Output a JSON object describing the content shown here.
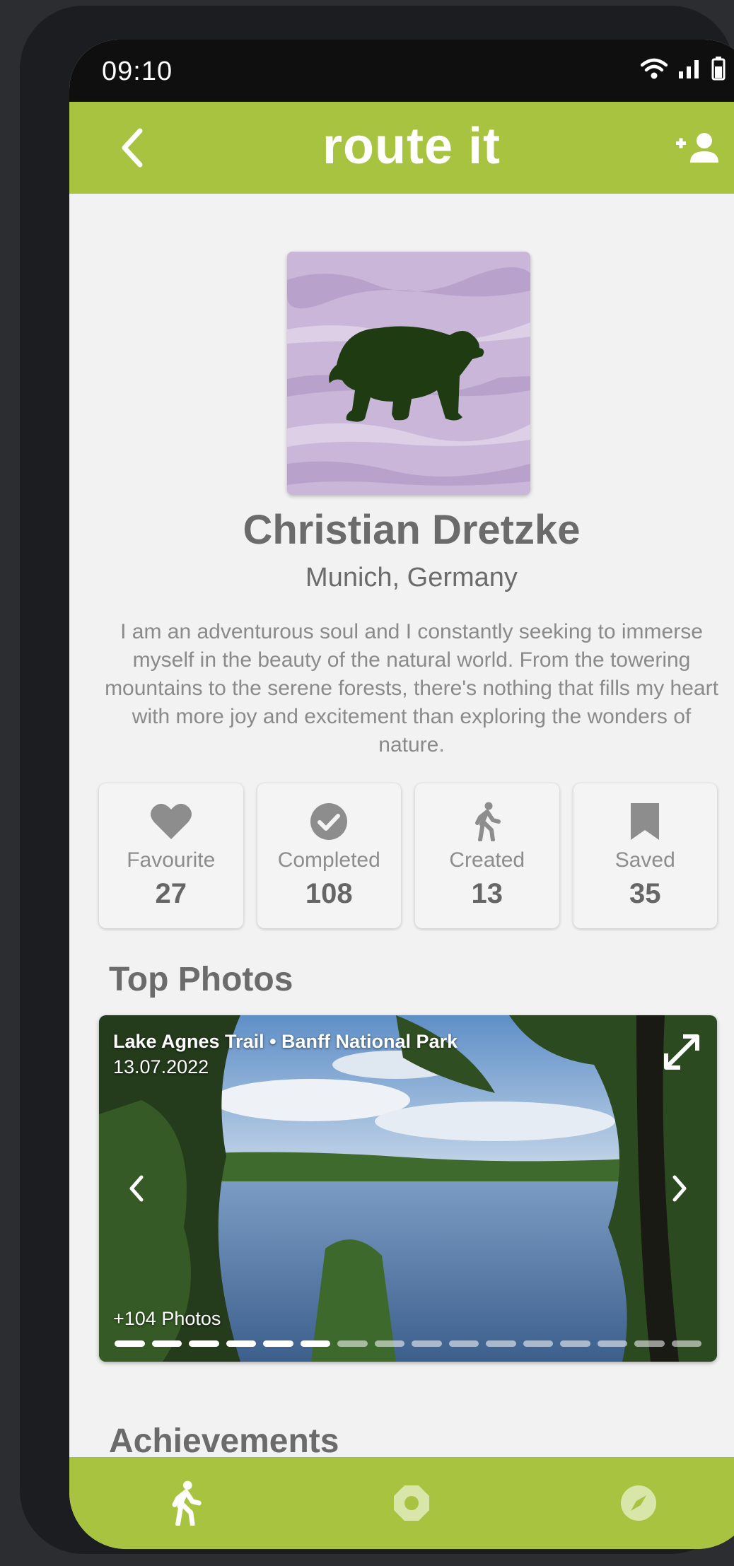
{
  "status_bar": {
    "time": "09:10"
  },
  "app_bar": {
    "title": "route it"
  },
  "profile": {
    "name": "Christian Dretzke",
    "location": "Munich, Germany",
    "bio": "I am an adventurous soul and I constantly seeking to immerse myself in the beauty of the natural world. From the towering mountains to the serene forests, there's nothing that fills my heart with more joy and excitement than exploring the wonders of nature."
  },
  "stats": [
    {
      "label": "Favourite",
      "value": "27",
      "icon": "heart-icon"
    },
    {
      "label": "Completed",
      "value": "108",
      "icon": "check-circle-icon"
    },
    {
      "label": "Created",
      "value": "13",
      "icon": "hiker-icon"
    },
    {
      "label": "Saved",
      "value": "35",
      "icon": "bookmark-icon"
    }
  ],
  "top_photos": {
    "title": "Top Photos",
    "caption": "Lake Agnes Trail • Banff National Park",
    "date": "13.07.2022",
    "more": "+104 Photos",
    "page_count": 16,
    "current_page": 6
  },
  "achievements": {
    "title": "Achievements"
  },
  "colors": {
    "accent": "#a8c33f",
    "text": "#6b6b6b",
    "background": "#f2f2f2"
  },
  "bottom_nav": [
    "hiker-icon",
    "octagon-icon",
    "compass-icon"
  ]
}
